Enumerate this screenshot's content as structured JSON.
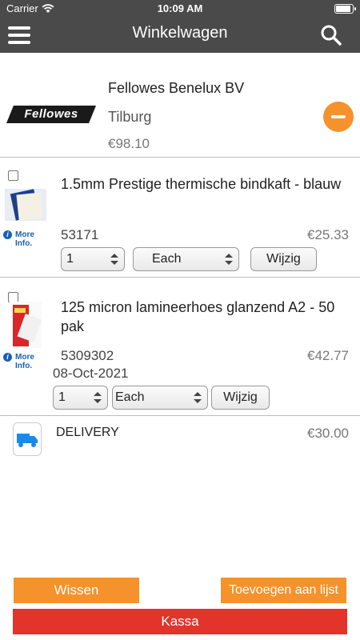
{
  "status_bar": {
    "carrier": "Carrier",
    "time": "10:09 AM",
    "battery_level": 0.9
  },
  "navbar": {
    "title": "Winkelwagen",
    "menu_icon": "hamburger-icon",
    "search_icon": "search-icon"
  },
  "supplier": {
    "logo_text": "Fellowes",
    "name": "Fellowes Benelux BV",
    "city": "Tilburg",
    "total": "€98.10",
    "remove_icon": "minus-circle-icon"
  },
  "items": [
    {
      "name": "1.5mm Prestige thermische bindkaft - blauw",
      "code": "53171",
      "price": "€25.33",
      "date": "",
      "quantity": "1",
      "unit": "Each",
      "change_label": "Wijzig",
      "more_info": "More Info."
    },
    {
      "name": "125 micron lamineerhoes glanzend A2 - 50 pak",
      "code": "5309302",
      "price": "€42.77",
      "date": "08-Oct-2021",
      "quantity": "1",
      "unit": "Each",
      "change_label": "Wijzig",
      "more_info": "More Info."
    }
  ],
  "delivery": {
    "label": "DELIVERY",
    "price": "€30.00",
    "icon": "truck-icon"
  },
  "footer": {
    "clear_label": "Wissen",
    "add_to_list_label": "Toevoegen aan lijst",
    "checkout_label": "Kassa"
  },
  "colors": {
    "header": "#4a4a4a",
    "accent_orange": "#f5922b",
    "checkout_red": "#e3342b",
    "link_blue": "#1a5fb4"
  }
}
